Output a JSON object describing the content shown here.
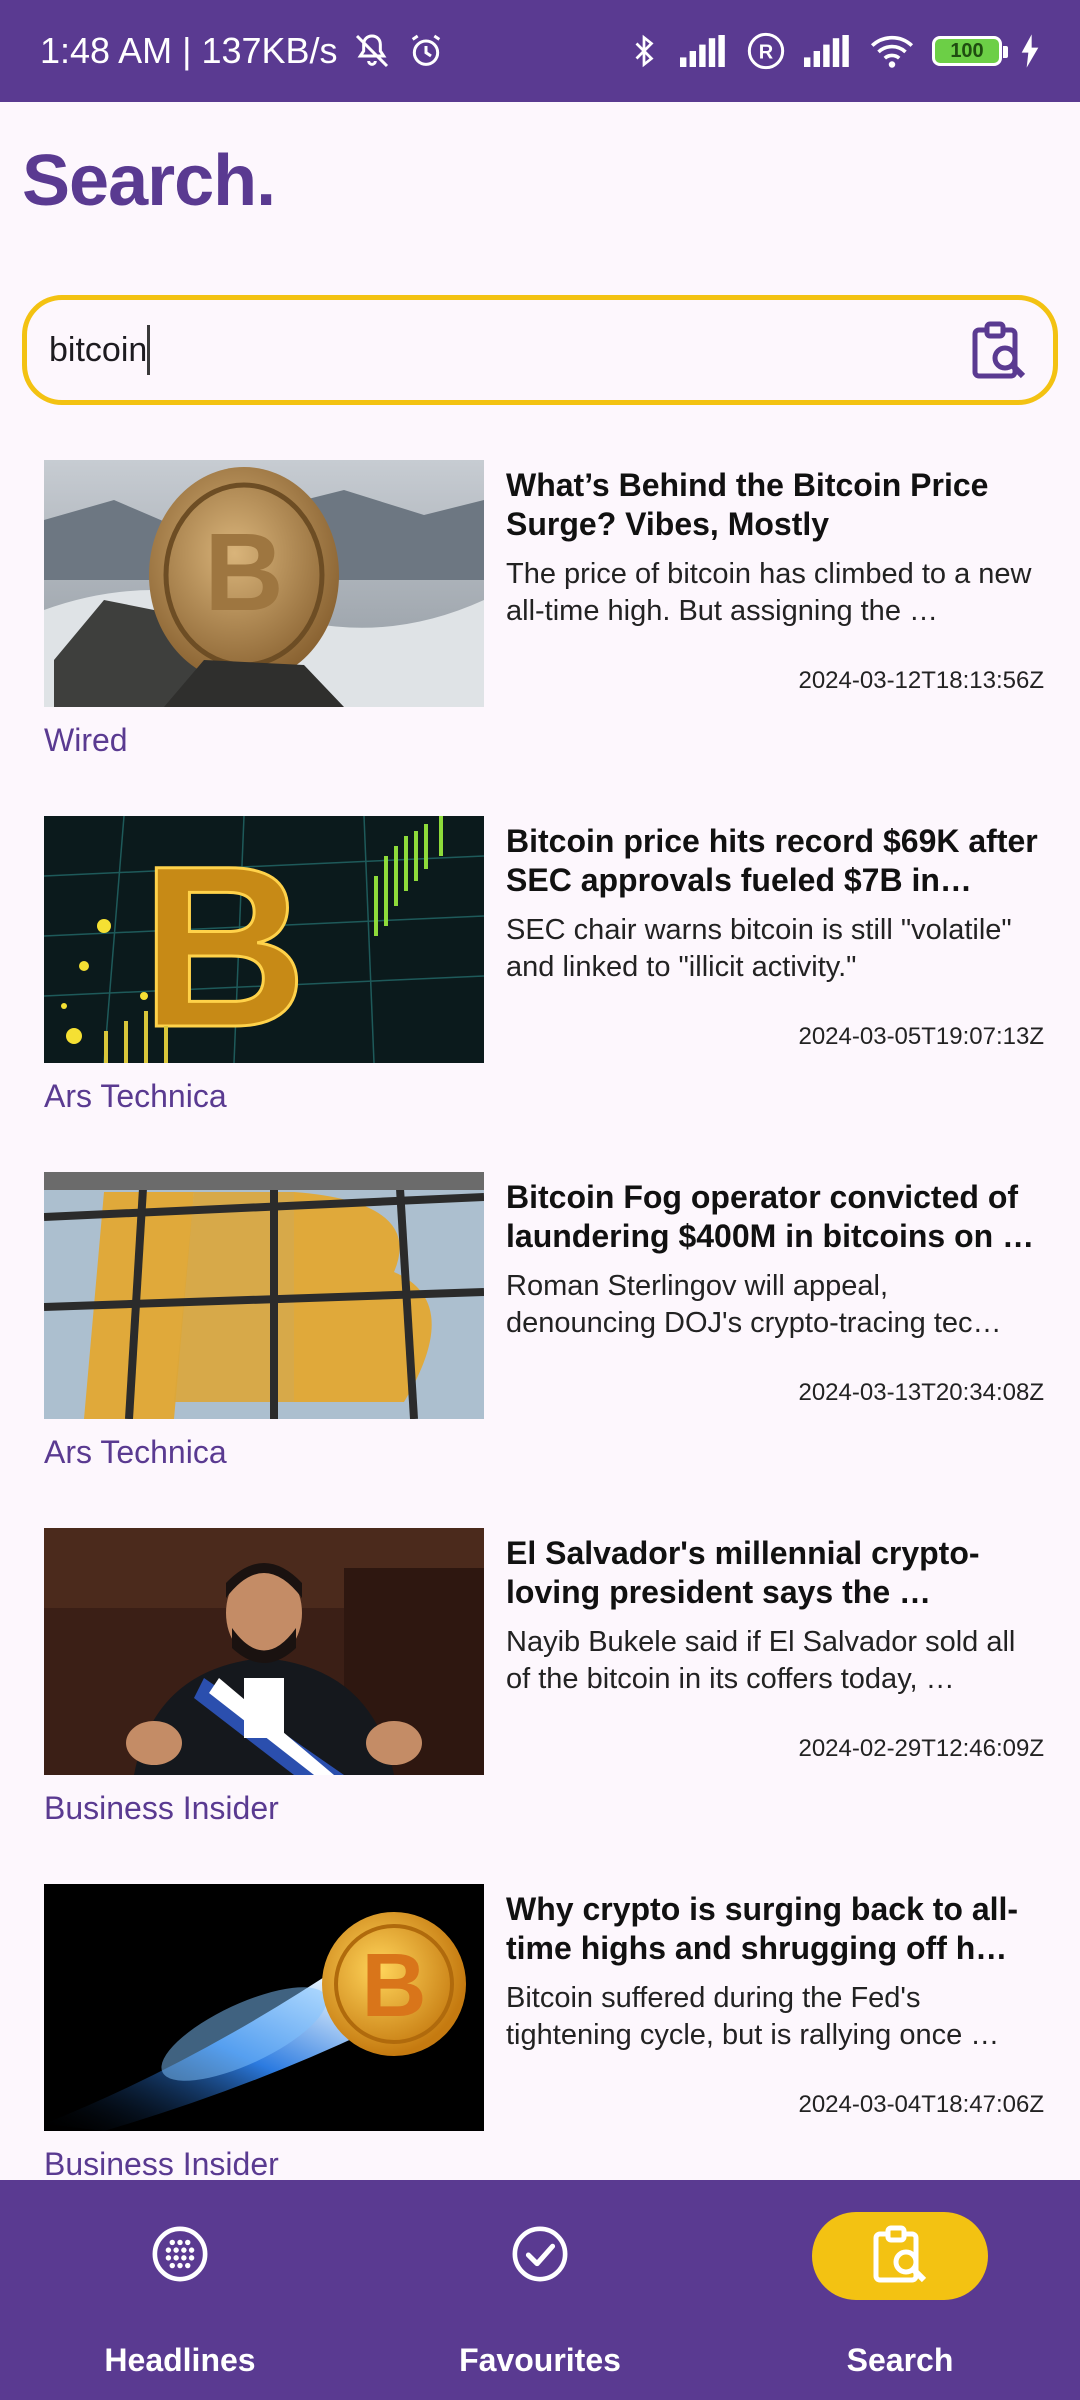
{
  "status_bar": {
    "time_speed": "1:48 AM | 137KB/s",
    "battery_level": "100",
    "icons": [
      "mute-icon",
      "alarm-icon",
      "bluetooth-icon",
      "signal-icon",
      "roaming-icon",
      "signal-icon",
      "wifi-icon",
      "battery-icon",
      "charging-icon"
    ]
  },
  "page": {
    "title": "Search."
  },
  "search": {
    "value": "bitcoin",
    "icon": "clipboard-search-icon"
  },
  "articles": [
    {
      "title": "What’s Behind the Bitcoin Price Surge? Vibes, Mostly",
      "description": "The price of bitcoin has climbed to a new all-time high. But assigning the …",
      "date": "2024-03-12T18:13:56Z",
      "source": "Wired",
      "image": "bitcoin-coin-on-rock-image"
    },
    {
      "title": "Bitcoin price hits record $69K after SEC approvals fueled $7B in…",
      "description": "SEC chair warns bitcoin is still \"volatile\" and linked to \"illicit activity.\"",
      "date": "2024-03-05T19:07:13Z",
      "source": "Ars Technica",
      "image": "bitcoin-chart-image"
    },
    {
      "title": "Bitcoin Fog operator convicted of laundering $400M in bitcoins on …",
      "description": "Roman Sterlingov will appeal, denouncing DOJ's crypto-tracing tec…",
      "date": "2024-03-13T20:34:08Z",
      "source": "Ars Technica",
      "image": "bitcoin-window-image"
    },
    {
      "title": "El Salvador's millennial crypto-loving president says the …",
      "description": "Nayib Bukele said if El Salvador sold all of the bitcoin in its coffers today, …",
      "date": "2024-02-29T12:46:09Z",
      "source": "Business Insider",
      "image": "president-photo-image"
    },
    {
      "title": "Why crypto is surging back to all-time highs and shrugging off h…",
      "description": "Bitcoin suffered during the Fed's tightening cycle, but is rallying once …",
      "date": "2024-03-04T18:47:06Z",
      "source": "Business Insider",
      "image": "bitcoin-comet-image"
    }
  ],
  "nav": {
    "items": [
      {
        "label": "Headlines",
        "icon": "grid-dots-icon",
        "active": false
      },
      {
        "label": "Favourites",
        "icon": "check-circle-icon",
        "active": false
      },
      {
        "label": "Search",
        "icon": "clipboard-search-icon",
        "active": true
      }
    ]
  },
  "colors": {
    "primary": "#5a3a91",
    "accent": "#f3c212",
    "background": "#fdf7fd"
  }
}
